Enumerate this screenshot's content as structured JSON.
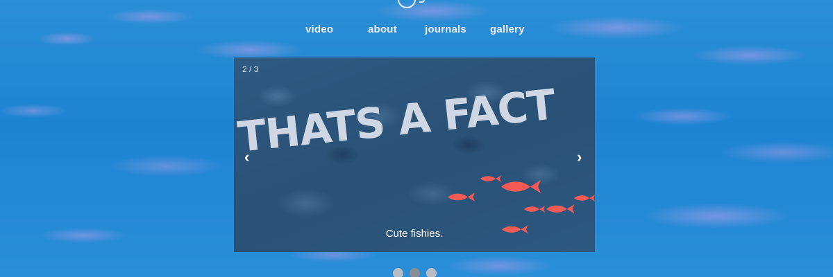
{
  "nav": {
    "items": [
      {
        "label": "video"
      },
      {
        "label": "about"
      },
      {
        "label": "journals"
      },
      {
        "label": "gallery"
      }
    ]
  },
  "slider": {
    "counter": "2 / 3",
    "headline": "THATS A FACT",
    "caption": "Cute fishies.",
    "prev_icon": "chevron-left-icon",
    "next_icon": "chevron-right-icon",
    "prev_symbol": "‹",
    "next_symbol": "›",
    "current_slide": 2,
    "total_slides": 3
  },
  "colors": {
    "ocean_blue": "#1e84d2",
    "ripple_lavender": "#969be6",
    "slide_background": "#2a5176",
    "headline_text": "#cfd6e4",
    "fish": "#f25a55",
    "dot_inactive": "#b8bcc4",
    "dot_active": "#8a8e96"
  }
}
